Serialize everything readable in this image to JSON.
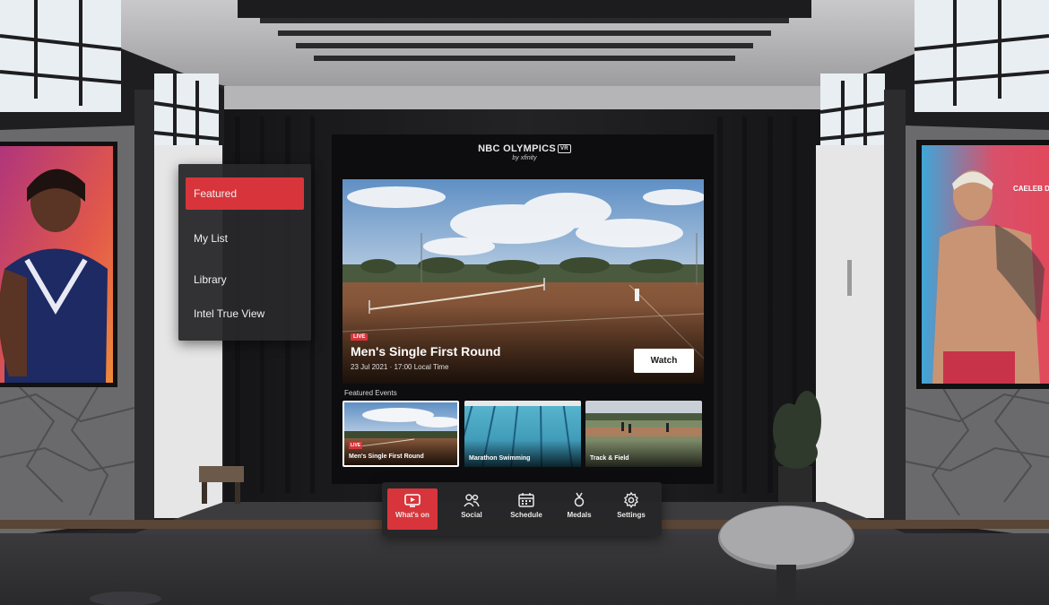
{
  "logo": {
    "brand": "NBC OLYMPICS",
    "badge": "VR",
    "sub": "by xfinity"
  },
  "side_menu": {
    "items": [
      {
        "label": "Featured",
        "active": true
      },
      {
        "label": "My List",
        "active": false
      },
      {
        "label": "Library",
        "active": false
      },
      {
        "label": "Intel True View",
        "active": false
      }
    ]
  },
  "hero": {
    "badge": "LIVE",
    "title": "Men's Single First Round",
    "date": "23 Jul 2021 · 17:00 Local Time",
    "watch_label": "Watch"
  },
  "featured": {
    "heading": "Featured Events",
    "cards": [
      {
        "label": "Men's Single First Round",
        "badge": "LIVE"
      },
      {
        "label": "Marathon Swimming"
      },
      {
        "label": "Track & Field"
      }
    ]
  },
  "poster_right": {
    "name": "CAELEB DRE"
  },
  "bottom_nav": {
    "items": [
      {
        "label": "What's on",
        "icon": "tv-icon",
        "active": true
      },
      {
        "label": "Social",
        "icon": "people-icon",
        "active": false
      },
      {
        "label": "Schedule",
        "icon": "calendar-icon",
        "active": false
      },
      {
        "label": "Medals",
        "icon": "medal-icon",
        "active": false
      },
      {
        "label": "Settings",
        "icon": "gear-icon",
        "active": false
      }
    ]
  },
  "colors": {
    "accent": "#d7353b",
    "panel": "#28282a",
    "text": "#f0f0f0"
  }
}
